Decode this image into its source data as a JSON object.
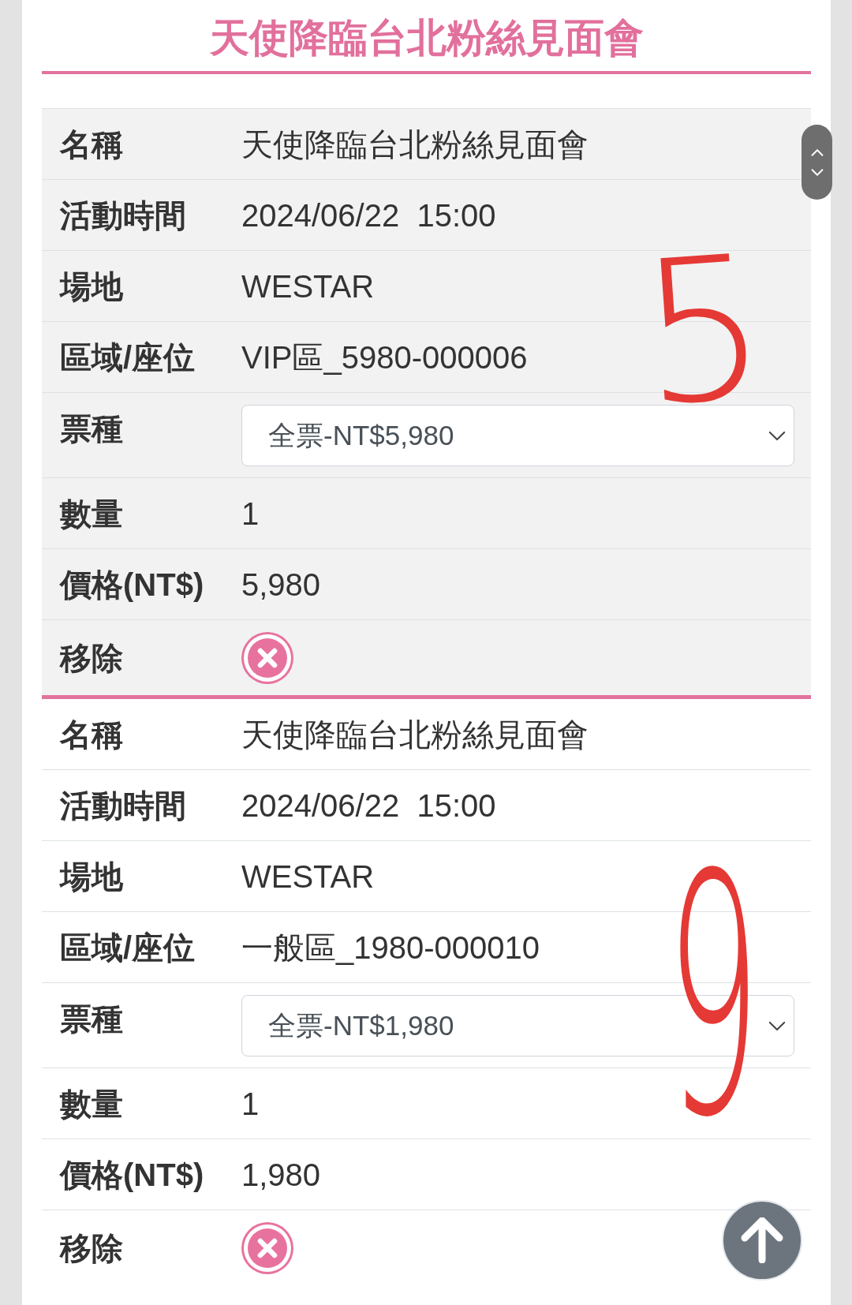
{
  "page_title": "天使降臨台北粉絲見面會",
  "items": [
    {
      "rows": [
        {
          "kind": "text",
          "label": "名稱",
          "value": "天使降臨台北粉絲見面會"
        },
        {
          "kind": "text",
          "label": "活動時間",
          "value": "2024/06/22  15:00"
        },
        {
          "kind": "text",
          "label": "場地",
          "value": "WESTAR"
        },
        {
          "kind": "text",
          "label": "區域/座位",
          "value": "VIP區_5980-000006"
        },
        {
          "kind": "select",
          "label": "票種",
          "value": "全票-NT$5,980"
        },
        {
          "kind": "text",
          "label": "數量",
          "value": "1"
        },
        {
          "kind": "text",
          "label": "價格(NT$)",
          "value": "5,980"
        },
        {
          "kind": "remove",
          "label": "移除"
        }
      ]
    },
    {
      "rows": [
        {
          "kind": "text",
          "label": "名稱",
          "value": "天使降臨台北粉絲見面會"
        },
        {
          "kind": "text",
          "label": "活動時間",
          "value": "2024/06/22  15:00"
        },
        {
          "kind": "text",
          "label": "場地",
          "value": "WESTAR"
        },
        {
          "kind": "text",
          "label": "區域/座位",
          "value": "一般區_1980-000010"
        },
        {
          "kind": "select",
          "label": "票種",
          "value": "全票-NT$1,980"
        },
        {
          "kind": "text",
          "label": "數量",
          "value": "1"
        },
        {
          "kind": "text",
          "label": "價格(NT$)",
          "value": "1,980"
        },
        {
          "kind": "remove",
          "label": "移除"
        }
      ]
    }
  ],
  "annotations": [
    {
      "text": "5"
    },
    {
      "text": "9"
    }
  ]
}
